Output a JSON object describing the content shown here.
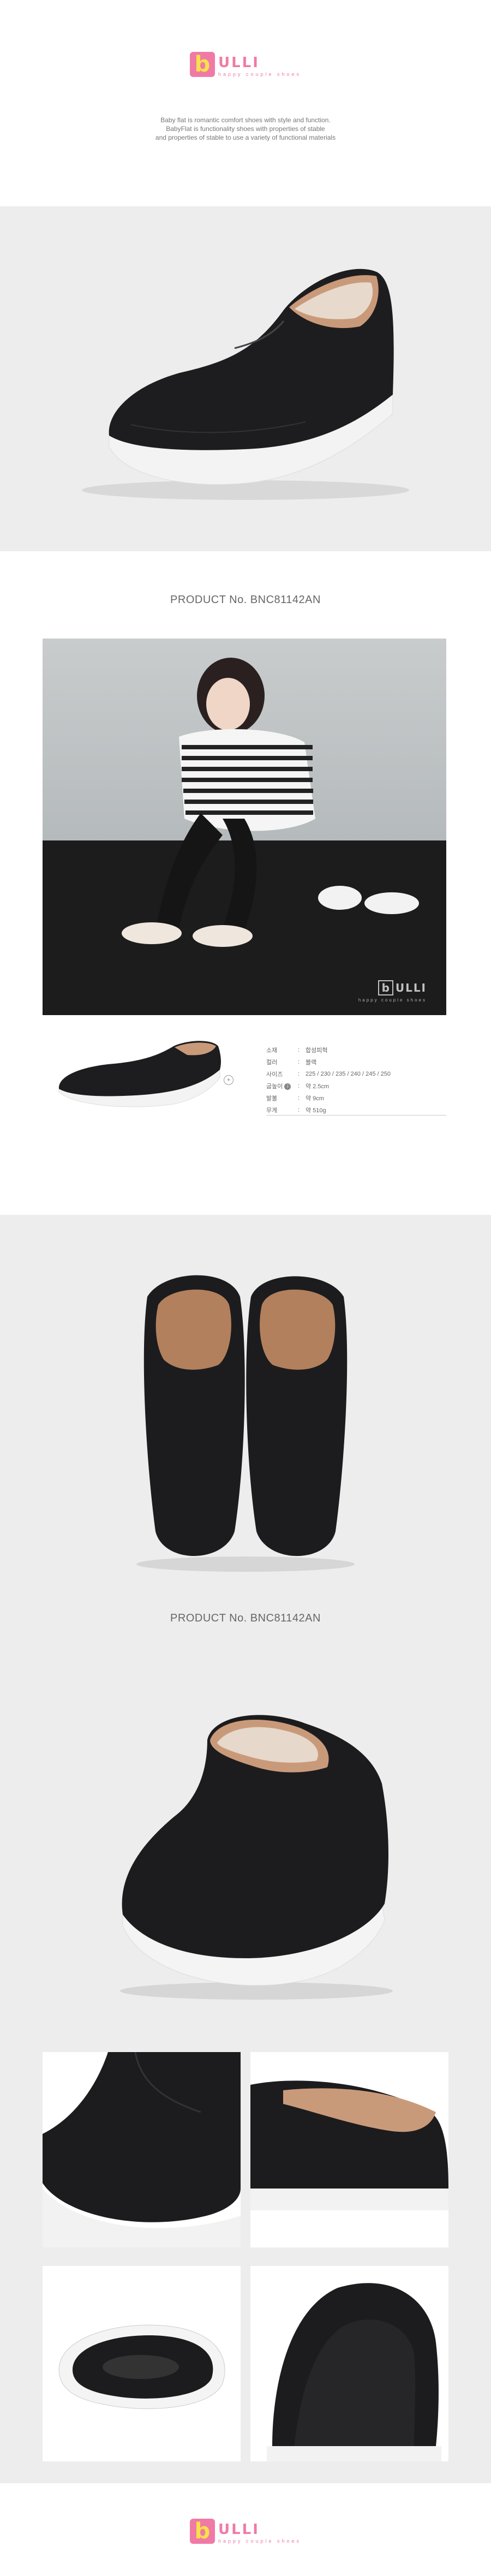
{
  "brand": {
    "wordmark": "ULLI",
    "letter": "b",
    "tagline": "happy couple shoes",
    "pink": "#f07aa6",
    "yellow": "#f7e04a"
  },
  "intro": {
    "line1": "Baby flat is romantic comfort shoes with style and function.",
    "line2": "BabyFlat is functionality shoes with properties of stable",
    "line3": "and properties of stable to use a variety of functional materials"
  },
  "product_code": "PRODUCT No. BNC81142AN",
  "photo_logo": {
    "letter": "b",
    "wordmark": "ULLI",
    "tagline": "happy couple shoes"
  },
  "spec": [
    {
      "label": "소재",
      "value": "합성피혁",
      "badge": false
    },
    {
      "label": "컬러",
      "value": "블랙",
      "badge": false
    },
    {
      "label": "사이즈",
      "value": "225 / 230 / 235 / 240 / 245 / 250",
      "badge": false
    },
    {
      "label": "굽높이",
      "value": "약 2.5cm",
      "badge": true
    },
    {
      "label": "발볼",
      "value": "약 9cm",
      "badge": false
    },
    {
      "label": "무게",
      "value": "약 510g",
      "badge": false
    }
  ],
  "colors": {
    "grey_bg": "#ededed",
    "shoe_black": "#1b1b1d",
    "leather_tan": "#b07a55",
    "sole_white": "#f4f4f4"
  }
}
